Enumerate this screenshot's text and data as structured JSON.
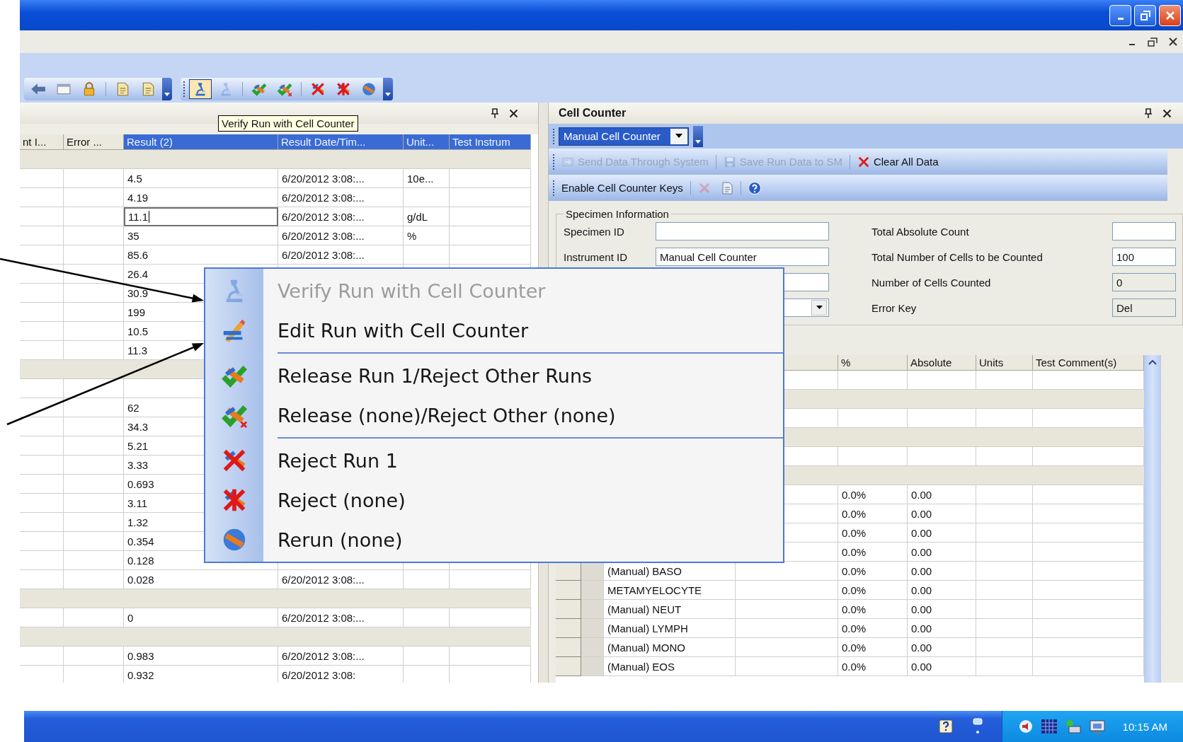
{
  "toolbars": [
    {
      "buttons": [
        {
          "kind": "back",
          "pressed": false,
          "disabled": false
        },
        {
          "kind": "window",
          "pressed": false,
          "disabled": false
        },
        {
          "kind": "lock",
          "pressed": false,
          "disabled": false
        },
        {
          "kind": "separator"
        },
        {
          "kind": "document",
          "pressed": false,
          "disabled": false
        },
        {
          "kind": "document",
          "pressed": false,
          "disabled": false
        },
        {
          "kind": "overflow"
        }
      ]
    },
    {
      "buttons": [
        {
          "kind": "grip"
        },
        {
          "kind": "microscope",
          "pressed": true,
          "disabled": false
        },
        {
          "kind": "microscope",
          "pressed": false,
          "disabled": true
        },
        {
          "kind": "separator"
        },
        {
          "kind": "release",
          "pressed": false,
          "disabled": false
        },
        {
          "kind": "release-all",
          "pressed": false,
          "disabled": false
        },
        {
          "kind": "separator"
        },
        {
          "kind": "reject",
          "pressed": false,
          "disabled": false
        },
        {
          "kind": "reject-all",
          "pressed": false,
          "disabled": false
        },
        {
          "kind": "rerun",
          "pressed": false,
          "disabled": false
        },
        {
          "kind": "overflow"
        }
      ]
    }
  ],
  "left_pane": {
    "tooltip": "Verify Run with Cell Counter",
    "columns": [
      {
        "label": "nt I...",
        "selected": false
      },
      {
        "label": "Error ...",
        "selected": false
      },
      {
        "label": "Result (2)",
        "selected": true
      },
      {
        "label": "Result Date/Tim...",
        "selected": true
      },
      {
        "label": "Unit...",
        "selected": true
      },
      {
        "label": "Test Instrum",
        "selected": true
      }
    ],
    "rows": [
      {
        "kind": "band"
      },
      {
        "kind": "data",
        "result": "4.5",
        "date": "6/20/2012 3:08:...",
        "unit": "10e...",
        "editing": false
      },
      {
        "kind": "data",
        "result": "4.19",
        "date": "6/20/2012 3:08:...",
        "editing": false
      },
      {
        "kind": "data",
        "result": "11.1",
        "date": "6/20/2012 3:08:...",
        "unit": "g/dL",
        "editing": true
      },
      {
        "kind": "data",
        "result": "35",
        "date": "6/20/2012 3:08:...",
        "unit": "%",
        "editing": false
      },
      {
        "kind": "data",
        "result": "85.6",
        "date": "6/20/2012 3:08:...",
        "editing": false
      },
      {
        "kind": "data",
        "result": "26.4",
        "editing": false
      },
      {
        "kind": "data",
        "result": "30.9",
        "editing": false
      },
      {
        "kind": "data",
        "result": "199",
        "editing": false
      },
      {
        "kind": "data",
        "result": "10.5",
        "editing": false
      },
      {
        "kind": "data",
        "result": "11.3",
        "editing": false
      },
      {
        "kind": "band"
      },
      {
        "kind": "blank"
      },
      {
        "kind": "data",
        "result": "62",
        "editing": false
      },
      {
        "kind": "data",
        "result": "34.3",
        "editing": false
      },
      {
        "kind": "data",
        "result": "5.21",
        "editing": false
      },
      {
        "kind": "data",
        "result": "3.33",
        "editing": false
      },
      {
        "kind": "data",
        "result": "0.693",
        "editing": false
      },
      {
        "kind": "data",
        "result": "3.11",
        "editing": false
      },
      {
        "kind": "data",
        "result": "1.32",
        "editing": false
      },
      {
        "kind": "data",
        "result": "0.354",
        "editing": false
      },
      {
        "kind": "data",
        "result": "0.128",
        "editing": false
      },
      {
        "kind": "data",
        "result": "0.028",
        "date": "6/20/2012 3:08:...",
        "editing": false
      },
      {
        "kind": "band"
      },
      {
        "kind": "data",
        "result": "0",
        "date": "6/20/2012 3:08:...",
        "editing": false
      },
      {
        "kind": "band"
      },
      {
        "kind": "data",
        "result": "0.983",
        "date": "6/20/2012 3:08:...",
        "editing": false
      },
      {
        "kind": "data",
        "result": "0.932",
        "date": "6/20/2012 3:08:",
        "editing": false
      }
    ]
  },
  "right_pane": {
    "title": "Cell Counter",
    "instrument": "Manual Cell Counter",
    "toolbar_rows": [
      {
        "items": [
          {
            "kind": "send",
            "label": "Send Data Through System",
            "disabled": true
          },
          {
            "kind": "separator"
          },
          {
            "kind": "save",
            "label": "Save Run Data to SM",
            "disabled": true
          },
          {
            "kind": "separator"
          },
          {
            "kind": "clear",
            "label": "Clear All Data",
            "disabled": false
          }
        ]
      },
      {
        "items": [
          {
            "kind": "keys",
            "label": "Enable Cell Counter Keys",
            "disabled": false
          },
          {
            "kind": "separator"
          },
          {
            "kind": "cancel",
            "disabled": true
          },
          {
            "kind": "import",
            "disabled": false
          },
          {
            "kind": "separator"
          },
          {
            "kind": "help",
            "disabled": false
          }
        ]
      }
    ],
    "specimen": {
      "title": "Specimen Information",
      "left_fields": [
        {
          "kind": "text",
          "label": "Specimen ID"
        },
        {
          "kind": "text",
          "label": "Instrument ID",
          "value": "Manual Cell Counter"
        },
        {
          "kind": "text"
        },
        {
          "kind": "dropdown"
        }
      ],
      "right_fields": [
        {
          "label": "Total Absolute Count",
          "disabled": false
        },
        {
          "label": "Total Number of Cells to be Counted",
          "value": "100",
          "disabled": false
        },
        {
          "label": "Number of Cells Counted",
          "value": "0",
          "disabled": true
        },
        {
          "label": "Error Key",
          "value": "Del",
          "disabled": true
        }
      ]
    },
    "columns": [
      "%",
      "Absolute",
      "Units",
      "Test Comment(s)"
    ],
    "rows": [
      {
        "kind": "blank"
      },
      {
        "kind": "band"
      },
      {
        "kind": "blank"
      },
      {
        "kind": "band"
      },
      {
        "kind": "blank"
      },
      {
        "kind": "band"
      },
      {
        "kind": "data",
        "percent": "0.0%",
        "absolute": "0.00"
      },
      {
        "kind": "data",
        "percent": "0.0%",
        "absolute": "0.00"
      },
      {
        "kind": "data",
        "percent": "0.0%",
        "absolute": "0.00"
      },
      {
        "kind": "data",
        "percent": "0.0%",
        "absolute": "0.00"
      },
      {
        "kind": "data",
        "name": "(Manual) BASO",
        "percent": "0.0%",
        "absolute": "0.00"
      },
      {
        "kind": "data",
        "name": "METAMYELOCYTE",
        "percent": "0.0%",
        "absolute": "0.00"
      },
      {
        "kind": "data",
        "name": "(Manual) NEUT",
        "percent": "0.0%",
        "absolute": "0.00"
      },
      {
        "kind": "data",
        "name": "(Manual) LYMPH",
        "percent": "0.0%",
        "absolute": "0.00"
      },
      {
        "kind": "data",
        "name": "(Manual) MONO",
        "percent": "0.0%",
        "absolute": "0.00"
      },
      {
        "kind": "data",
        "name": "(Manual) EOS",
        "percent": "0.0%",
        "absolute": "0.00"
      }
    ]
  },
  "context_menu": {
    "items": [
      {
        "kind": "verify",
        "label": "Verify Run with Cell Counter",
        "disabled": true
      },
      {
        "kind": "edit",
        "label": "Edit Run with Cell Counter",
        "disabled": false
      },
      {
        "kind": "separator"
      },
      {
        "kind": "release",
        "label": "Release Run 1/Reject Other Runs",
        "disabled": false
      },
      {
        "kind": "release-all",
        "label": "Release (none)/Reject Other (none)",
        "disabled": false
      },
      {
        "kind": "separator"
      },
      {
        "kind": "reject",
        "label": "Reject Run 1",
        "disabled": false
      },
      {
        "kind": "reject-all",
        "label": "Reject (none)",
        "disabled": false
      },
      {
        "kind": "rerun",
        "label": "Rerun (none)",
        "disabled": false
      }
    ]
  },
  "taskbar": {
    "clock": "10:15 AM"
  }
}
